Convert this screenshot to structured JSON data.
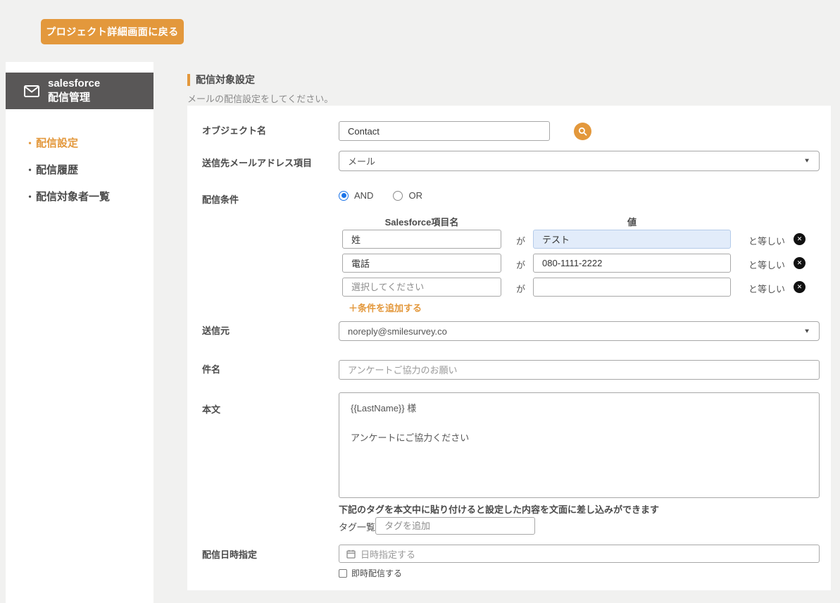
{
  "page": {
    "back_button": "プロジェクト詳細画面に戻る"
  },
  "sidebar": {
    "bullet": "・",
    "title_line1": "salesforce",
    "title_line2": "配信管理",
    "items": [
      {
        "label": "配信設定",
        "active": true
      },
      {
        "label": "配信履歴",
        "active": false
      },
      {
        "label": "配信対象者一覧",
        "active": false
      }
    ]
  },
  "main": {
    "section_title": "配信対象設定",
    "section_subtitle": "メールの配信設定をしてください。",
    "object_name": {
      "label": "オブジェクト名",
      "value": "Contact"
    },
    "email_field": {
      "label": "送信先メールアドレス項目",
      "value": "メール"
    },
    "conditions": {
      "label": "配信条件",
      "and_label": "AND",
      "or_label": "OR",
      "selected_operator": "AND",
      "col_field_header": "Salesforce項目名",
      "col_value_header": "値",
      "connector": "が",
      "operator_label": "と等しい",
      "rows": [
        {
          "field": "姓",
          "value": "テスト"
        },
        {
          "field": "電話",
          "value": "080-1111-2222"
        },
        {
          "field_placeholder": "選択してください",
          "value": ""
        }
      ],
      "add_link": "＋条件を追加する"
    },
    "sender": {
      "label": "送信元",
      "value": "noreply@smilesurvey.co"
    },
    "subject": {
      "label": "件名",
      "placeholder": "アンケートご協力のお願い"
    },
    "body": {
      "label": "本文",
      "value": "{{LastName}} 様\n\nアンケートにご協力ください"
    },
    "tags": {
      "note": "下記のタグを本文中に貼り付けると設定した内容を文面に差し込みができます",
      "label": "タグ一覧",
      "placeholder": "タグを追加"
    },
    "schedule": {
      "label": "配信日時指定",
      "placeholder": "日時指定する",
      "immediate_label": "即時配信する",
      "immediate_checked": false
    }
  },
  "icons": {
    "close": "✕",
    "dropdown_arrow": "▼"
  },
  "colors": {
    "accent": "#e3983c",
    "sidebar_header": "#595757",
    "highlight_input_bg": "#e2ecfa",
    "radio_checked": "#1a73e8",
    "remove_button": "#111111",
    "page_bg": "#f1f1f0",
    "panel_bg": "#ffffff"
  }
}
